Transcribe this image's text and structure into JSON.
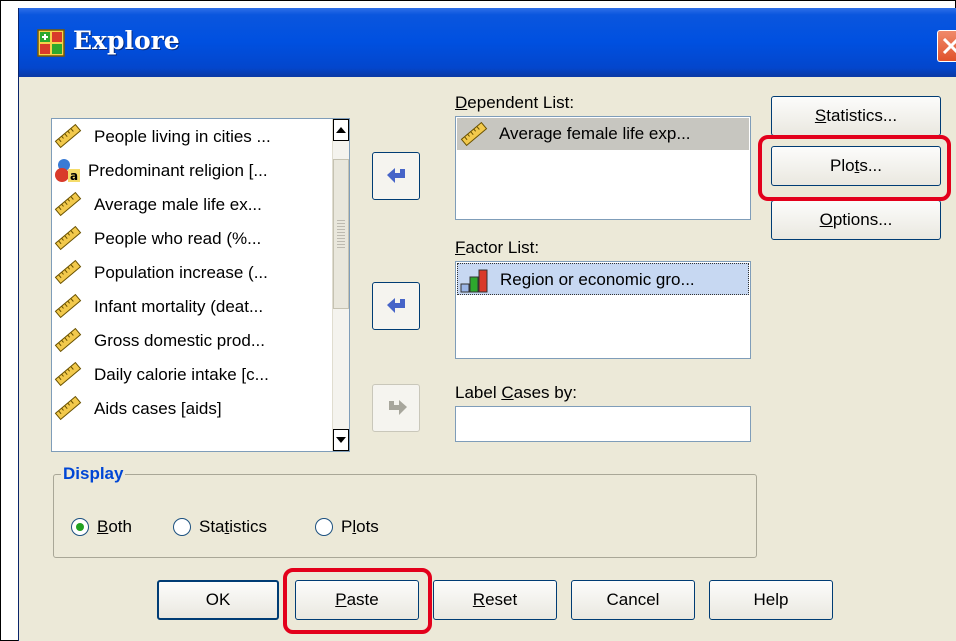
{
  "window": {
    "title": "Explore",
    "accent": "#0050e0"
  },
  "source_list": {
    "items": [
      {
        "label": "People living in cities ...",
        "icon": "scale-ruler-icon"
      },
      {
        "label": "Predominant religion [...",
        "icon": "nominal-variable-icon"
      },
      {
        "label": "Average male life ex...",
        "icon": "scale-ruler-icon"
      },
      {
        "label": "People who read (%...",
        "icon": "scale-ruler-icon"
      },
      {
        "label": "Population increase (...",
        "icon": "scale-ruler-icon"
      },
      {
        "label": "Infant mortality (deat...",
        "icon": "scale-ruler-icon"
      },
      {
        "label": "Gross domestic prod...",
        "icon": "scale-ruler-icon"
      },
      {
        "label": "Daily calorie intake [c...",
        "icon": "scale-ruler-icon"
      },
      {
        "label": "Aids cases [aids]",
        "icon": "scale-ruler-icon"
      }
    ]
  },
  "dependent": {
    "label_prefix": "",
    "label_u": "D",
    "label_rest": "ependent List:",
    "items": [
      {
        "label": "Average female life exp...",
        "icon": "scale-ruler-icon"
      }
    ]
  },
  "factor": {
    "label_u": "F",
    "label_rest": "actor List:",
    "items": [
      {
        "label": "Region or economic gro...",
        "icon": "ordinal-bar-icon"
      }
    ]
  },
  "label_cases": {
    "label_prefix": "Label ",
    "label_u": "C",
    "label_rest": "ases by:",
    "value": ""
  },
  "side_buttons": {
    "statistics": {
      "u": "S",
      "rest": "tatistics..."
    },
    "plots": {
      "pre": "Plo",
      "u": "t",
      "rest": "s..."
    },
    "options": {
      "u": "O",
      "rest": "ptions..."
    }
  },
  "display": {
    "legend": "Display",
    "options": [
      {
        "u": "B",
        "rest": "oth",
        "selected": true
      },
      {
        "pre": "Sta",
        "u": "t",
        "rest": "istics",
        "selected": false
      },
      {
        "pre": "P",
        "u": "l",
        "rest": "ots",
        "selected": false
      }
    ]
  },
  "bottom_buttons": {
    "ok": "OK",
    "paste": {
      "u": "P",
      "rest": "aste"
    },
    "reset": {
      "u": "R",
      "rest": "eset"
    },
    "cancel": "Cancel",
    "help": "Help"
  },
  "highlight_color": "#e3001b"
}
